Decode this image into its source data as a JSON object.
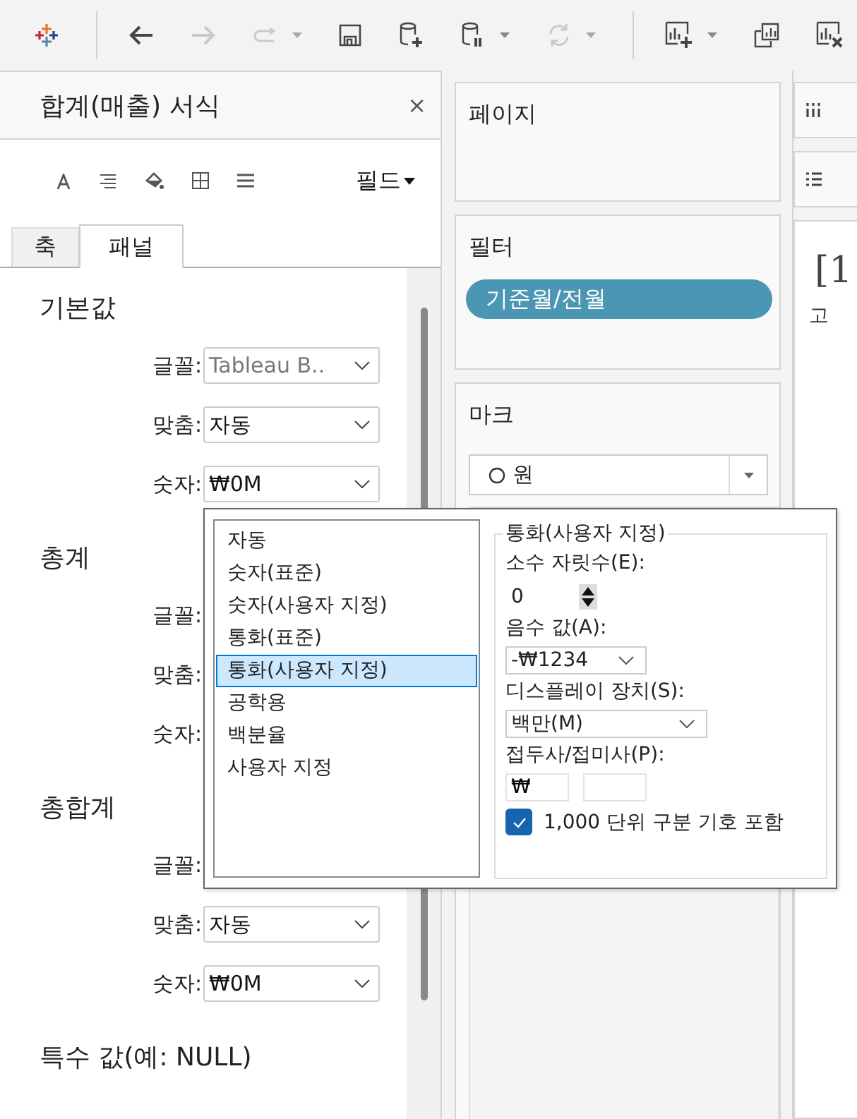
{
  "toolbar": [
    {
      "kind": "logo",
      "disabled": false,
      "menu": false,
      "separator_before": false
    },
    {
      "kind": "back",
      "disabled": false,
      "menu": false,
      "separator_before": true
    },
    {
      "kind": "forward",
      "disabled": true,
      "menu": false,
      "separator_before": false
    },
    {
      "kind": "redo",
      "disabled": true,
      "menu": true,
      "separator_before": false
    },
    {
      "kind": "save",
      "disabled": false,
      "menu": false,
      "separator_before": false
    },
    {
      "kind": "add-data",
      "disabled": false,
      "menu": false,
      "separator_before": false
    },
    {
      "kind": "pause-data",
      "disabled": false,
      "menu": true,
      "separator_before": false
    },
    {
      "kind": "refresh",
      "disabled": true,
      "menu": true,
      "separator_before": false
    },
    {
      "kind": "new-sheet",
      "disabled": false,
      "menu": true,
      "separator_before": true
    },
    {
      "kind": "duplicate-sheet",
      "disabled": false,
      "menu": false,
      "separator_before": false
    },
    {
      "kind": "clear-sheet",
      "disabled": false,
      "menu": false,
      "separator_before": false
    }
  ],
  "format_pane": {
    "title": "합계(매출) 서식",
    "close": "×",
    "field_menu": "필드",
    "tabs": [
      {
        "label": "축",
        "selected": false
      },
      {
        "label": "패널",
        "selected": true
      }
    ],
    "sections": [
      {
        "title": "기본값",
        "rows": [
          {
            "label": "글꼴:",
            "value": "Tableau B..",
            "muted": true
          },
          {
            "label": "맞춤:",
            "value": "자동",
            "muted": false
          },
          {
            "label": "숫자:",
            "value": "₩0M",
            "muted": false
          }
        ]
      },
      {
        "title": "총계",
        "rows": [
          {
            "label": "글꼴:"
          },
          {
            "label": "맞춤:"
          },
          {
            "label": "숫자:"
          }
        ]
      },
      {
        "title": "총합계",
        "rows": [
          {
            "label": "글꼴:"
          },
          {
            "label": "맞춤:",
            "value": "자동",
            "muted": false
          },
          {
            "label": "숫자:",
            "value": "₩0M",
            "muted": false
          }
        ]
      },
      {
        "title": "특수 값(예: NULL)"
      }
    ]
  },
  "shelves": {
    "pages": {
      "title": "페이지"
    },
    "filters": {
      "title": "필터",
      "pills": [
        "기준월/전월"
      ]
    },
    "marks": {
      "title": "마크",
      "mark_type": "원"
    }
  },
  "view": {
    "title": "[1",
    "subtitle": "고"
  },
  "number_format_popup": {
    "categories": [
      {
        "label": "자동",
        "selected": false
      },
      {
        "label": "숫자(표준)",
        "selected": false
      },
      {
        "label": "숫자(사용자 지정)",
        "selected": false
      },
      {
        "label": "통화(표준)",
        "selected": false
      },
      {
        "label": "통화(사용자 지정)",
        "selected": true
      },
      {
        "label": "공학용",
        "selected": false
      },
      {
        "label": "백분율",
        "selected": false
      },
      {
        "label": "사용자 지정",
        "selected": false
      }
    ],
    "group": {
      "legend": "통화(사용자 지정)",
      "decimals_label": "소수 자릿수(E):",
      "decimals": "0",
      "negative_label": "음수 값(A):",
      "negative": "-₩1234",
      "units_label": "디스플레이 장치(S):",
      "units": "백만(M)",
      "affix_label": "접두사/접미사(P):",
      "prefix": "₩",
      "thousands_label": "1,000 단위 구분 기호 포함",
      "thousands_checked": true
    }
  }
}
